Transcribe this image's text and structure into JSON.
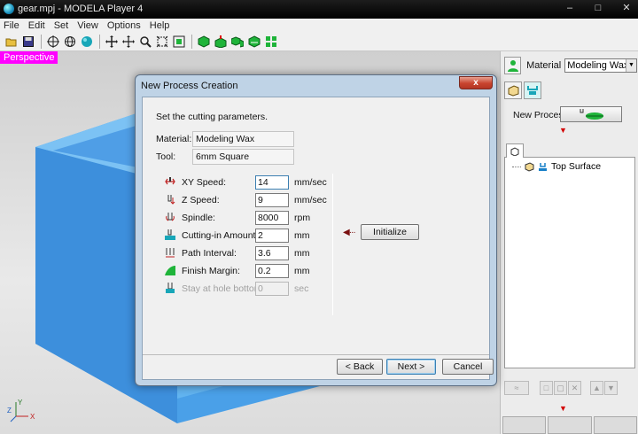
{
  "window": {
    "title": "gear.mpj - MODELA Player 4"
  },
  "menu": [
    "File",
    "Edit",
    "Set",
    "View",
    "Options",
    "Help"
  ],
  "viewport": {
    "mode_label": "Perspective",
    "axis": {
      "x": "X",
      "y": "Y",
      "z": "Z"
    }
  },
  "right_panel": {
    "material_label": "Material",
    "material_value": "Modeling Wax",
    "new_process_label": "New Process",
    "tree": {
      "items": [
        "Top Surface"
      ]
    }
  },
  "dialog": {
    "title": "New Process Creation",
    "close_glyph": "x",
    "intro": "Set the cutting parameters.",
    "material_label": "Material:",
    "material_value": "Modeling Wax",
    "tool_label": "Tool:",
    "tool_value": "6mm Square",
    "params": [
      {
        "label": "XY Speed:",
        "value": "14",
        "unit": "mm/sec",
        "enabled": true
      },
      {
        "label": "Z Speed:",
        "value": "9",
        "unit": "mm/sec",
        "enabled": true
      },
      {
        "label": "Spindle:",
        "value": "8000",
        "unit": "rpm",
        "enabled": true
      },
      {
        "label": "Cutting-in Amount:",
        "value": "2",
        "unit": "mm",
        "enabled": true
      },
      {
        "label": "Path Interval:",
        "value": "3.6",
        "unit": "mm",
        "enabled": true
      },
      {
        "label": "Finish Margin:",
        "value": "0.2",
        "unit": "mm",
        "enabled": true
      },
      {
        "label": "Stay at hole bottom:",
        "value": "0",
        "unit": "sec",
        "enabled": false
      }
    ],
    "initialize_label": "Initialize",
    "back_label": "< Back",
    "next_label": "Next >",
    "cancel_label": "Cancel"
  },
  "colors": {
    "model_blue": "#4aa0e8",
    "perspective_badge": "#ff00ff",
    "green_icon": "#1fb43a"
  }
}
